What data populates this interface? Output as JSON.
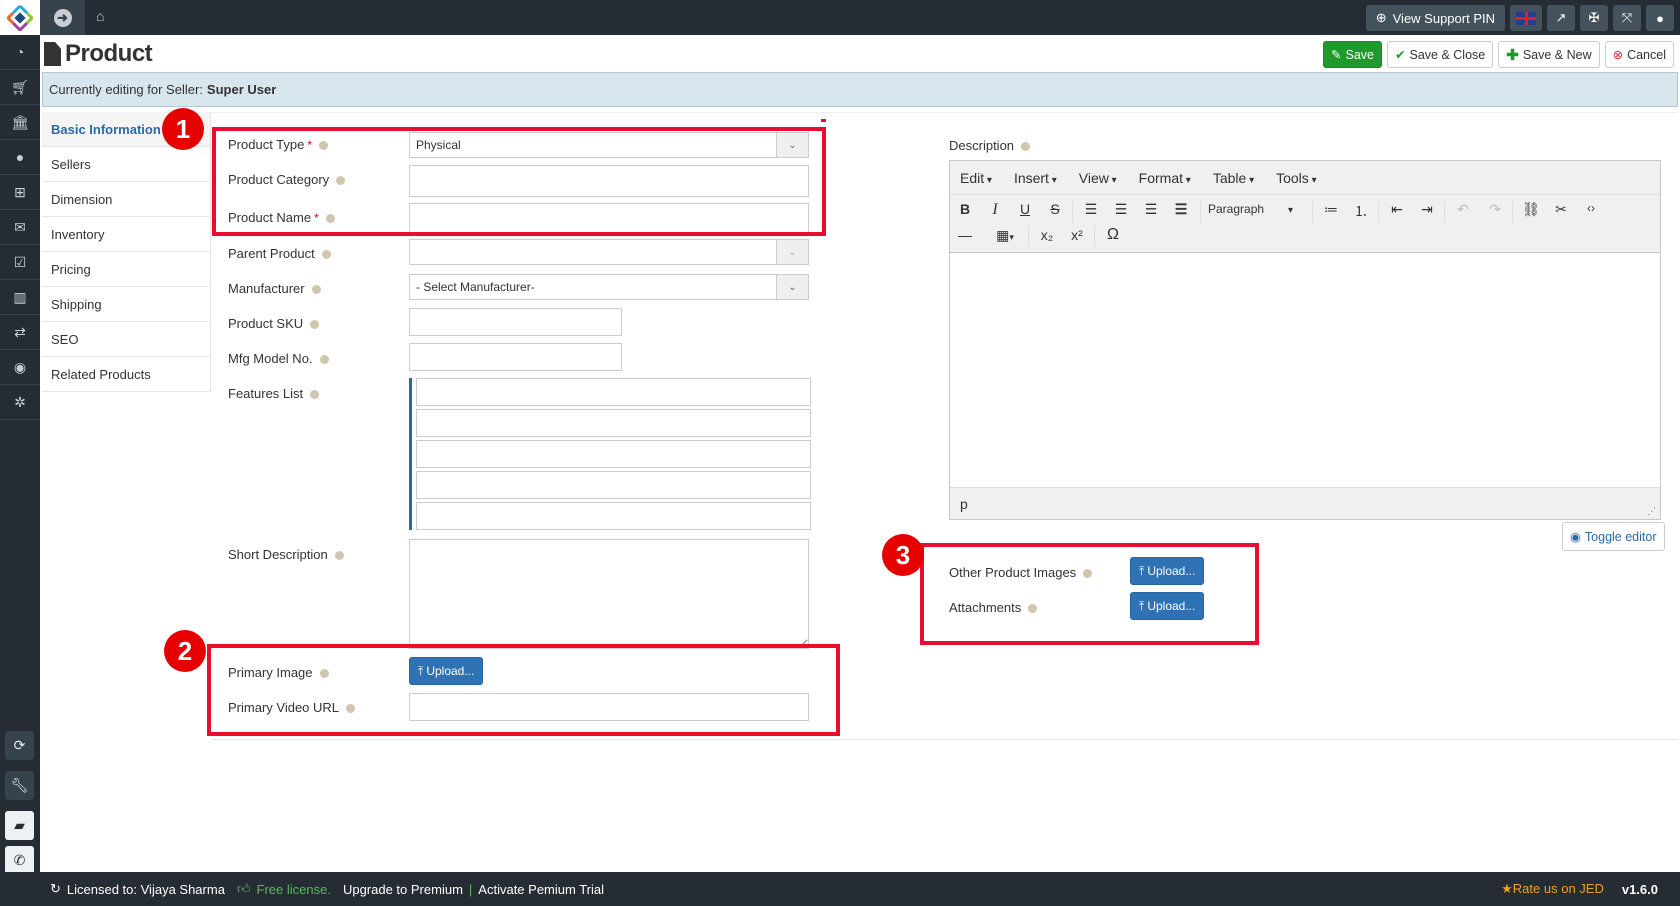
{
  "topbar": {
    "support_label": "View Support PIN",
    "icons": [
      "arrow-right-circle-icon",
      "home-icon",
      "lifebuoy-icon",
      "uk-flag-icon",
      "external-link-icon",
      "joomla-icon",
      "fullscreen-icon",
      "user-icon"
    ]
  },
  "sidebar": {
    "icons": [
      "dashboard-icon",
      "cart-icon",
      "bank-icon",
      "user-icon",
      "sitemap-icon",
      "envelope-icon",
      "checkbox-icon",
      "bar-chart-icon",
      "exchange-icon",
      "globe-icon",
      "gear-icon"
    ],
    "bottom_icons": [
      "refresh-icon",
      "wrench-icon",
      "book-icon",
      "phone-icon"
    ]
  },
  "header": {
    "title": "Product",
    "buttons": {
      "save": "Save",
      "save_close": "Save & Close",
      "save_new": "Save & New",
      "cancel": "Cancel"
    }
  },
  "banner": {
    "prefix": "Currently editing for Seller:",
    "seller": "Super User"
  },
  "tabs": [
    "Basic Information",
    "Sellers",
    "Dimension",
    "Inventory",
    "Pricing",
    "Shipping",
    "SEO",
    "Related Products"
  ],
  "active_tab": "Basic Information",
  "form": {
    "product_type": {
      "label": "Product Type",
      "required": "*",
      "value": "Physical"
    },
    "product_category": {
      "label": "Product Category",
      "value": ""
    },
    "product_name": {
      "label": "Product Name",
      "required": "*",
      "value": ""
    },
    "parent_product": {
      "label": "Parent Product",
      "value": ""
    },
    "manufacturer": {
      "label": "Manufacturer",
      "value": "- Select Manufacturer-"
    },
    "product_sku": {
      "label": "Product SKU",
      "value": ""
    },
    "mfg_model": {
      "label": "Mfg Model No.",
      "value": ""
    },
    "features": {
      "label": "Features List",
      "values": [
        "",
        "",
        "",
        "",
        ""
      ]
    },
    "short_description": {
      "label": "Short Description",
      "value": ""
    },
    "primary_image": {
      "label": "Primary Image",
      "button": "Upload..."
    },
    "primary_video": {
      "label": "Primary Video URL",
      "value": ""
    },
    "description": {
      "label": "Description"
    },
    "other_images": {
      "label": "Other Product Images",
      "button": "Upload..."
    },
    "attachments": {
      "label": "Attachments",
      "button": "Upload..."
    }
  },
  "editor": {
    "menus": [
      "Edit",
      "Insert",
      "View",
      "Format",
      "Table",
      "Tools"
    ],
    "format_select": "Paragraph",
    "status_path": "p",
    "toggle_label": "Toggle editor"
  },
  "annotations": [
    "1",
    "2",
    "3"
  ],
  "footer": {
    "licensed": "Licensed to: Vijaya Sharma",
    "free": "Free license.",
    "upgrade": "Upgrade to Premium",
    "divider": "|",
    "trial": "Activate Pemium Trial",
    "rate": "Rate us on JED",
    "version": "v1.6.0"
  }
}
